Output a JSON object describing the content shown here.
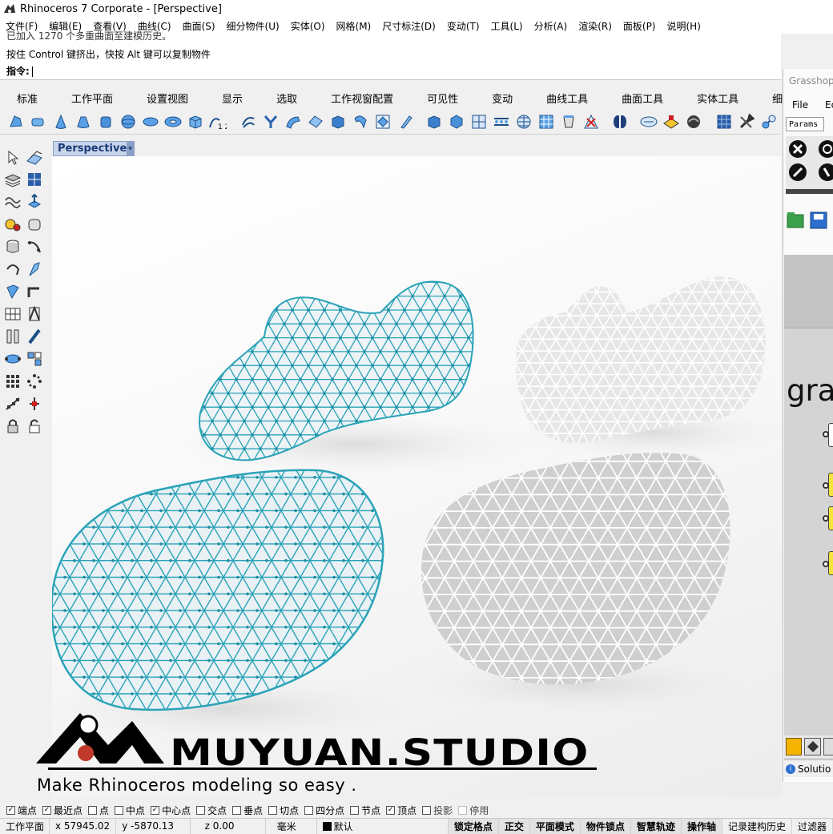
{
  "window": {
    "title": "Rhinoceros 7 Corporate - [Perspective]"
  },
  "menu": [
    "文件(F)",
    "编辑(E)",
    "查看(V)",
    "曲线(C)",
    "曲面(S)",
    "细分物件(U)",
    "实体(O)",
    "网格(M)",
    "尺寸标注(D)",
    "变动(T)",
    "工具(L)",
    "分析(A)",
    "渲染(R)",
    "面板(P)",
    "说明(H)"
  ],
  "command": {
    "history_partial": "已加入 1270 个多重曲面至建模历史。",
    "hint": "按住 Control 键挤出，快按 Alt 键可以复制物件",
    "prompt_label": "指令:"
  },
  "tabs": [
    "标准",
    "工作平面",
    "设置视图",
    "显示",
    "选取",
    "工作视窗配置",
    "可见性",
    "变动",
    "曲线工具",
    "曲面工具",
    "实体工具",
    "细分工具"
  ],
  "viewport": {
    "name": "Perspective",
    "dropdown": "▾"
  },
  "grasshopper": {
    "title": "Grasshopper",
    "menu_file": "File",
    "menu_edit": "Ec",
    "params_tab": "Params",
    "canvas_text": "gra",
    "solution": "Solutio"
  },
  "watermark": {
    "brand": "MUYUAN.STUDIO",
    "tagline": "Make Rhinoceros modeling so easy ."
  },
  "osnaps": [
    {
      "label": "端点",
      "checked": true
    },
    {
      "label": "最近点",
      "checked": true
    },
    {
      "label": "点",
      "checked": false
    },
    {
      "label": "中点",
      "checked": false
    },
    {
      "label": "中心点",
      "checked": true
    },
    {
      "label": "交点",
      "checked": false
    },
    {
      "label": "垂点",
      "checked": false
    },
    {
      "label": "切点",
      "checked": false
    },
    {
      "label": "四分点",
      "checked": false
    },
    {
      "label": "节点",
      "checked": false
    },
    {
      "label": "顶点",
      "checked": true
    },
    {
      "label": "投影",
      "checked": false
    },
    {
      "label": "停用",
      "checked": false
    }
  ],
  "status": {
    "cplane": "工作平面",
    "x": "x 57945.02",
    "y": "y -5870.13",
    "z": "z 0.00",
    "units": "毫米",
    "layer": "默认",
    "toggles": [
      "锁定格点",
      "正交",
      "平面模式",
      "物件锁点",
      "智慧轨迹",
      "操作轴",
      "记录建构历史",
      "过滤器"
    ]
  },
  "colors": {
    "accent_mesh": "#2aa3b8",
    "white_mesh": "#ffffff",
    "viewport_tab": "#c8d4ea"
  }
}
